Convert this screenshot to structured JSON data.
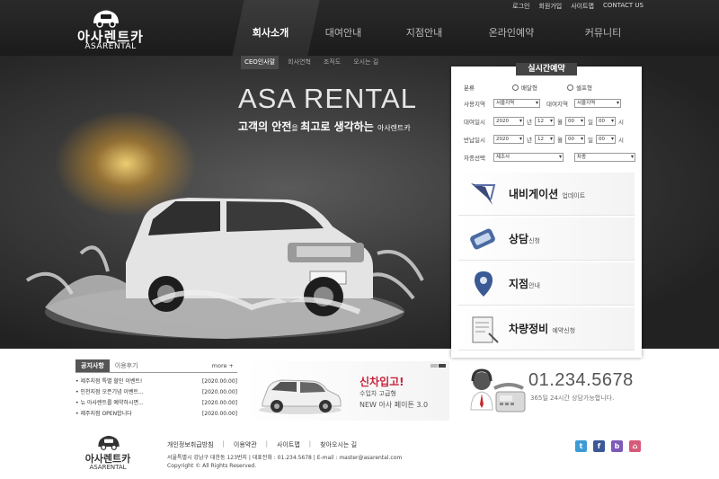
{
  "brand": {
    "name_ko": "아사렌트카",
    "name_en": "ASARENTAL"
  },
  "util_links": [
    "로그인",
    "회원가입",
    "사이트맵",
    "CONTACT US"
  ],
  "gnb": [
    "회사소개",
    "대여안내",
    "지점안내",
    "온라인예약",
    "커뮤니티"
  ],
  "gnb_active": "회사소개",
  "sub_menu": [
    "CEO인사말",
    "회사연혁",
    "조직도",
    "오시는 길"
  ],
  "hero": {
    "title": "ASA RENTAL",
    "subtitle_a": "고객의 안전",
    "subtitle_b": "을 ",
    "subtitle_c": "최고로 생각하는",
    "subtitle_small": "아사렌트카"
  },
  "reservation": {
    "title": "실시간예약",
    "type_label": "분류",
    "type_options": [
      "배달형",
      "셀프형"
    ],
    "area_label": "사용지역",
    "area_value": "서울지역",
    "rent_area_label": "대여지역",
    "rent_area_value": "서울지역",
    "rent_date_label": "대여일시",
    "return_date_label": "반납일시",
    "year": "2020",
    "year_unit": "년",
    "month": "12",
    "month_unit": "월",
    "day": "00",
    "day_unit": "일",
    "hour": "00",
    "hour_unit": "시",
    "car_label": "차종선택",
    "maker_value": "제조사",
    "model_value": "차종"
  },
  "services": [
    {
      "name": "내비게이션",
      "suffix": "업데이트",
      "icon": "navigation-icon"
    },
    {
      "name": "상담",
      "suffix": "신청",
      "icon": "consult-icon"
    },
    {
      "name": "지점",
      "suffix": "안내",
      "icon": "branch-icon"
    },
    {
      "name": "차량정비",
      "suffix": "예약신청",
      "icon": "maintenance-icon"
    }
  ],
  "notice": {
    "tabs": [
      "공지사항",
      "이용후기"
    ],
    "more": "more +",
    "items": [
      {
        "title": "제주지점 특별 할인 이벤트!",
        "date": "[2020.00.00]"
      },
      {
        "title": "인천지점 오픈기념 이벤트...",
        "date": "[2020.00.00]"
      },
      {
        "title": "뉴 아사렌트를 예약하시면...",
        "date": "[2020.00.00]"
      },
      {
        "title": "제주지점 OPEN합니다",
        "date": "[2020.00.00]"
      }
    ]
  },
  "promo": {
    "line1": "신차입고!",
    "line2": "수입차 고급형",
    "line3": "NEW 아사 페이튼 3.0"
  },
  "callcenter": {
    "phone": "01.234.5678",
    "note": "365일 24시간 상담가능합니다."
  },
  "footer": {
    "links": [
      "개인정보취급방침",
      "이용약관",
      "사이트맵",
      "찾아오시는 길"
    ],
    "address": "서울특별시 강남구 대한동 123번지  |  대표전화 : 01.234.5678  |  E-mail : master@asarental.com",
    "copyright": "Copyright © All Rights Reserved.",
    "sns": [
      {
        "name": "twitter-icon",
        "glyph": "t",
        "color": "#3d9bd6"
      },
      {
        "name": "facebook-icon",
        "glyph": "f",
        "color": "#3b5998"
      },
      {
        "name": "blog-icon",
        "glyph": "b",
        "color": "#7d5ab8"
      },
      {
        "name": "home-icon",
        "glyph": "⌂",
        "color": "#d65a7a"
      }
    ]
  }
}
